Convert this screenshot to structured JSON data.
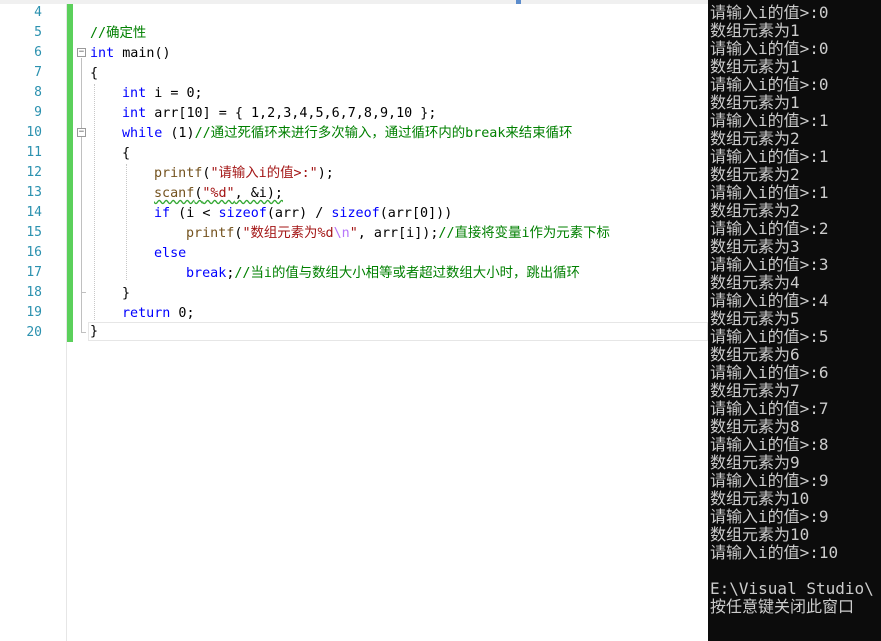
{
  "editor": {
    "line_numbers": [
      "4",
      "5",
      "6",
      "7",
      "8",
      "9",
      "10",
      "11",
      "12",
      "13",
      "14",
      "15",
      "16",
      "17",
      "18",
      "19",
      "20"
    ],
    "code": {
      "l5_comment": "//确定性",
      "l6_type": "int",
      "l6_rest": " main()",
      "l7": "{",
      "l8_type": "int",
      "l8_rest": " i = 0;",
      "l9_type": "int",
      "l9_rest": " arr[10] = { 1,2,3,4,5,6,7,8,9,10 };",
      "l10_kw": "while",
      "l10_rest": " (1)",
      "l10_comment": "//通过死循环来进行多次输入，通过循环内的break来结束循环",
      "l11": "{",
      "l12_fn": "printf",
      "l12_open": "(",
      "l12_str": "\"请输入i的值>:\"",
      "l12_close": ");",
      "l13_fn": "scanf",
      "l13_open": "(",
      "l13_str": "\"%d\"",
      "l13_rest": ", &i);",
      "l14_kw1": "if",
      "l14_a": " (i < ",
      "l14_kw2": "sizeof",
      "l14_b": "(arr) / ",
      "l14_kw3": "sizeof",
      "l14_c": "(arr[0]))",
      "l15_fn": "printf",
      "l15_open": "(",
      "l15_str1": "\"数组元素为%d",
      "l15_esc": "\\n",
      "l15_str2": "\"",
      "l15_rest": ", arr[i]);",
      "l15_comment": "//直接将变量i作为元素下标",
      "l16_kw": "else",
      "l17_kw": "break",
      "l17_rest": ";",
      "l17_comment": "//当i的值与数组大小相等或者超过数组大小时，跳出循环",
      "l18": "}",
      "l19_kw": "return",
      "l19_rest": " 0;",
      "l20": "}"
    }
  },
  "console": {
    "lines": [
      "请输入i的值>:0",
      "数组元素为1",
      "请输入i的值>:0",
      "数组元素为1",
      "请输入i的值>:0",
      "数组元素为1",
      "请输入i的值>:1",
      "数组元素为2",
      "请输入i的值>:1",
      "数组元素为2",
      "请输入i的值>:1",
      "数组元素为2",
      "请输入i的值>:2",
      "数组元素为3",
      "请输入i的值>:3",
      "数组元素为4",
      "请输入i的值>:4",
      "数组元素为5",
      "请输入i的值>:5",
      "数组元素为6",
      "请输入i的值>:6",
      "数组元素为7",
      "请输入i的值>:7",
      "数组元素为8",
      "请输入i的值>:8",
      "数组元素为9",
      "请输入i的值>:9",
      "数组元素为10",
      "请输入i的值>:9",
      "数组元素为10",
      "请输入i的值>:10",
      "",
      "E:\\Visual Studio\\",
      "按任意键关闭此窗口"
    ]
  }
}
